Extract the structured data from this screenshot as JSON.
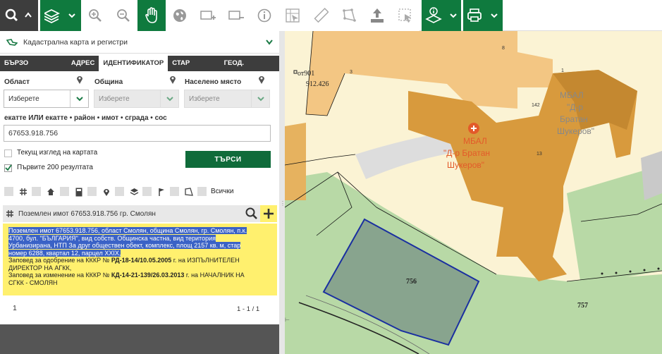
{
  "toolbar": {
    "buttons": [
      {
        "name": "search-menu-button",
        "icon": "search-icon",
        "style": "dark"
      },
      {
        "name": "layers-button",
        "icon": "layers-icon",
        "style": "green"
      },
      {
        "name": "zoom-in-button",
        "icon": "zoom-in-icon",
        "style": "plain"
      },
      {
        "name": "zoom-out-button",
        "icon": "zoom-out-icon",
        "style": "plain"
      },
      {
        "name": "pan-button",
        "icon": "hand-icon",
        "style": "green"
      },
      {
        "name": "full-extent-button",
        "icon": "globe-icon",
        "style": "plain"
      },
      {
        "name": "select-area-button",
        "icon": "select-plus-icon",
        "style": "plain"
      },
      {
        "name": "select-remove-button",
        "icon": "select-minus-icon",
        "style": "plain"
      },
      {
        "name": "info-button",
        "icon": "info-icon",
        "style": "plain"
      },
      {
        "name": "coordinates-button",
        "icon": "ruler-grid-icon",
        "style": "plain"
      },
      {
        "name": "measure-distance-button",
        "icon": "ruler-icon",
        "style": "plain"
      },
      {
        "name": "measure-area-button",
        "icon": "polygon-icon",
        "style": "plain"
      },
      {
        "name": "upload-button",
        "icon": "upload-icon",
        "style": "plain"
      },
      {
        "name": "clear-selection-button",
        "icon": "cursor-box-icon",
        "style": "plain"
      },
      {
        "name": "layer-info-button",
        "icon": "layer-info-icon",
        "style": "green"
      },
      {
        "name": "print-button",
        "icon": "printer-icon",
        "style": "green"
      }
    ]
  },
  "header": {
    "title": "Кадастрална карта и регистри"
  },
  "tabs": [
    {
      "label": "БЪРЗО ТЪРСЕНЕ",
      "active": false
    },
    {
      "label": "АДРЕС",
      "active": false
    },
    {
      "label": "ИДЕНТИФИКАТОР",
      "active": true
    },
    {
      "label": "СТАР ИДЕНТ.",
      "active": false
    },
    {
      "label": "ГЕОД. ОСНОВА",
      "active": false
    }
  ],
  "filters": {
    "region": {
      "label": "Област",
      "value": "Изберете"
    },
    "municipality": {
      "label": "Община",
      "value": "Изберете"
    },
    "settlement": {
      "label": "Населено място",
      "value": "Изберете"
    }
  },
  "identifier": {
    "label": "екатте ИЛИ екатте • район • имот • сграда • сос",
    "value": "67653.918.756"
  },
  "options": {
    "current_view": {
      "label": "Текущ изглед на картата",
      "checked": false
    },
    "first_200": {
      "label": "Първите 200 резултата",
      "checked": true
    }
  },
  "search_button": "ТЪРСИ",
  "type_filter": {
    "all_label": "Всички"
  },
  "result": {
    "title": "Поземлен имот 67653.918.756 гр. Смолян",
    "desc_lines": [
      "Поземлен имот 67653.918.756, област Смолян, община Смолян, гр. Смолян, п.к.",
      "4700, бул. \"БЪЛГАРИЯ\", вид собств. Общинска частна, вид територия",
      "Урбанизирана, НТП За друг обществен обект, комплекс, площ 2157 кв. м, стар",
      "номер 6288, квартал 12, парцел XXIX,"
    ],
    "order1_prefix": "Заповед за одобрение на КККР №",
    "order1_num": "РД-18-14/10.05.2005",
    "order1_suffix_a": "г. на ИЗПЪЛНИТЕЛЕН",
    "order1_suffix_b": "ДИРЕКТОР НА АГКК,",
    "order2_prefix": "Заповед за изменение на КККР №",
    "order2_num": "КД-14-21-139/26.03.2013",
    "order2_suffix_a": "г. на НАЧАЛНИК НА",
    "order2_suffix_b": "СГКК - СМОЛЯН"
  },
  "pagination": {
    "page": "1",
    "range": "1 - 1 / 1"
  },
  "map": {
    "labels": {
      "point_id": "от901",
      "point_elev": "912.426",
      "hosp_short": "МБАЛ",
      "hosp_name_1": "\"Д-р Братан",
      "hosp_name_2": "Шукеров\"",
      "gray_label_1": "МБАЛ",
      "gray_label_2": "\"Д-р",
      "gray_label_3": "Братан",
      "gray_label_4": "Шукеров\"",
      "parcel_756": "756",
      "parcel_757": "757",
      "small_8": "8",
      "small_1": "1",
      "small_3": "3",
      "small_42": "142",
      "small_13": "13"
    },
    "colors": {
      "parcel_outline": "#1a2fa0",
      "building": "#e0a43a",
      "green": "#a9d39a",
      "hospital": "#e35a2a"
    }
  }
}
